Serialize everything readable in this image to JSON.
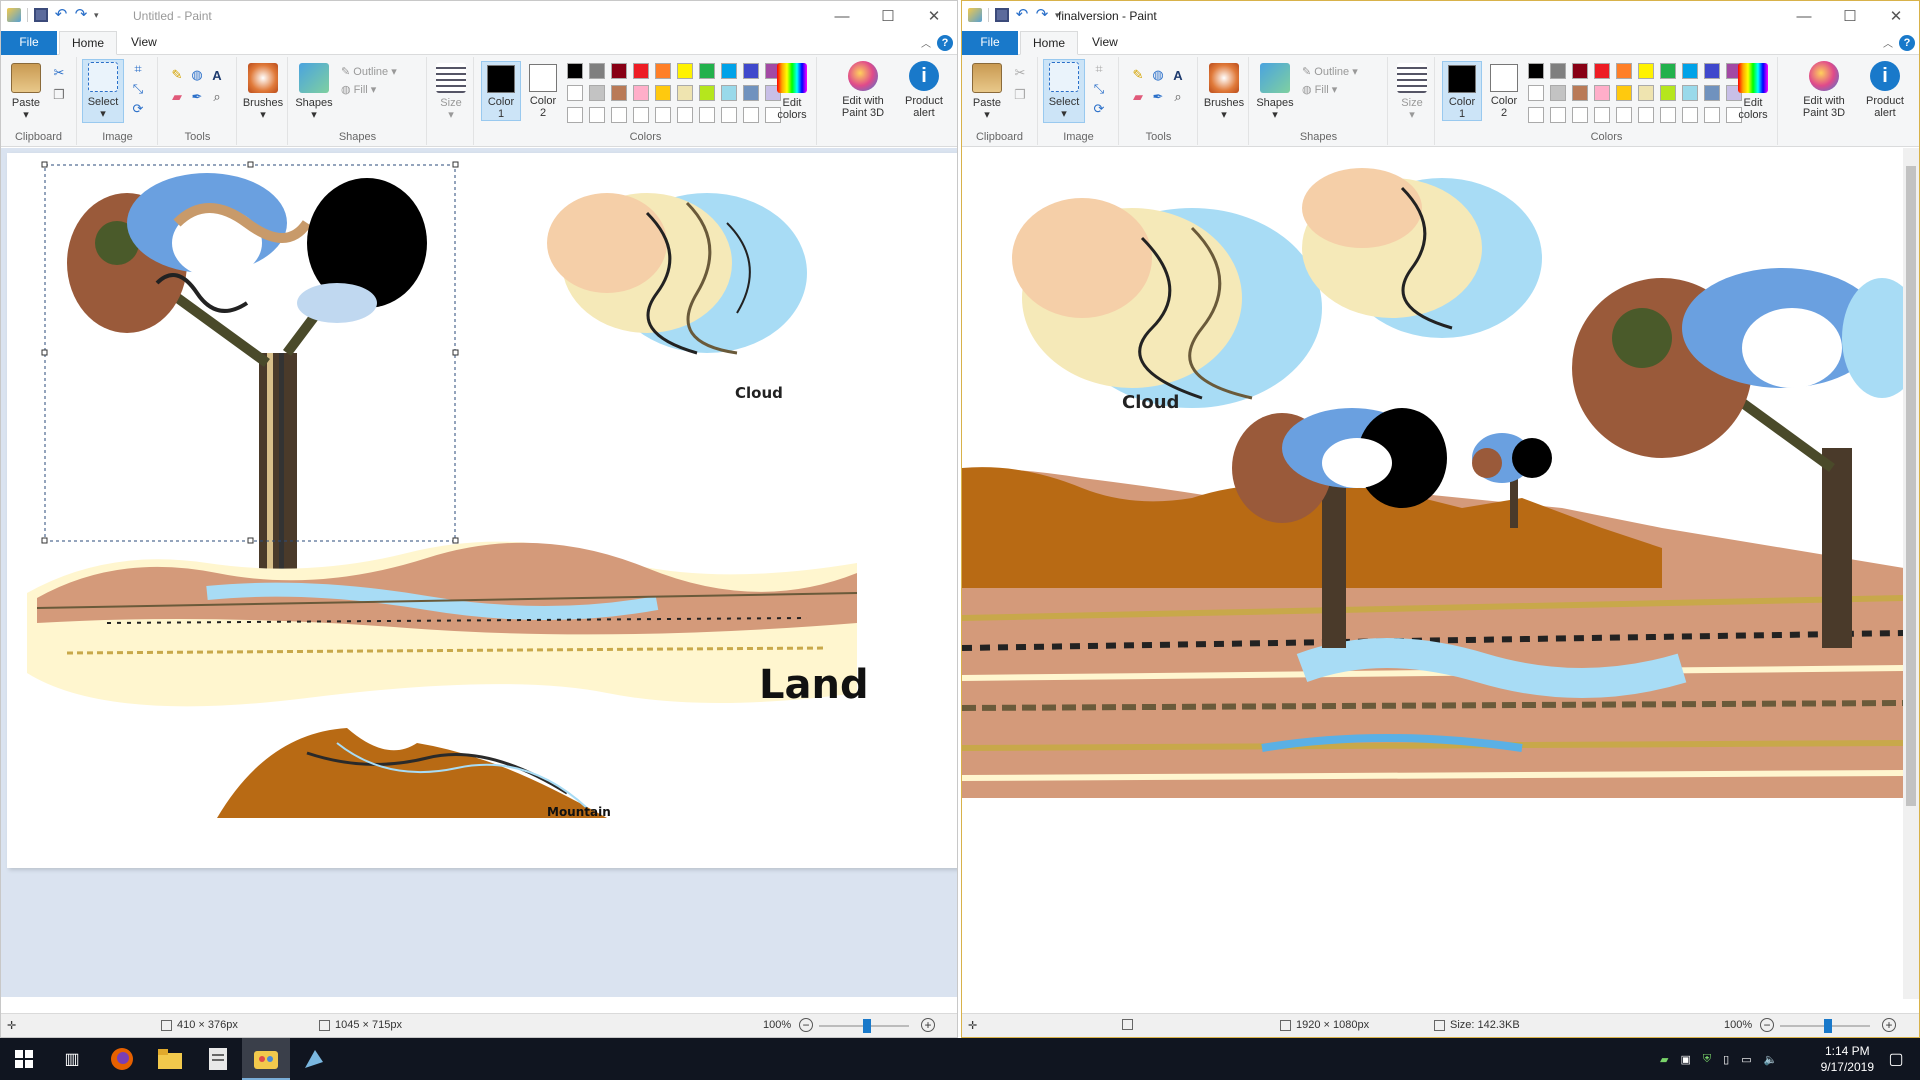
{
  "colors": {
    "accent": "#1979ca",
    "canvas_bg": "#dae3f0",
    "taskbar": "#101520"
  },
  "left_window": {
    "title": "Untitled - Paint",
    "tabs": {
      "file": "File",
      "home": "Home",
      "view": "View"
    },
    "status": {
      "selection_size": "410 × 376px",
      "image_size": "1045 × 715px",
      "zoom": "100%"
    },
    "canvas_labels": {
      "cloud": "Cloud",
      "land": "Land",
      "mountain": "Mountain"
    }
  },
  "right_window": {
    "title": "finalversion - Paint",
    "tabs": {
      "file": "File",
      "home": "Home",
      "view": "View"
    },
    "status": {
      "image_size": "1920 × 1080px",
      "file_size": "Size: 142.3KB",
      "zoom": "100%"
    },
    "canvas_labels": {
      "cloud": "Cloud"
    }
  },
  "ribbon": {
    "paste": "Paste",
    "clipboard": "Clipboard",
    "select": "Select",
    "image": "Image",
    "tools": "Tools",
    "brushes": "Brushes",
    "shapes": "Shapes",
    "shapes_group": "Shapes",
    "outline": "Outline",
    "fill": "Fill",
    "size": "Size",
    "color1": "Color",
    "color1_num": "1",
    "color2": "Color",
    "color2_num": "2",
    "colors_group": "Colors",
    "edit_colors": "Edit",
    "edit_colors2": "colors",
    "edit_paint3d": "Edit with",
    "edit_paint3d2": "Paint 3D",
    "product_alert": "Product",
    "product_alert2": "alert",
    "palette": [
      "#000000",
      "#7f7f7f",
      "#880015",
      "#ed1c24",
      "#ff7f27",
      "#fff200",
      "#22b14c",
      "#00a2e8",
      "#3f48cc",
      "#a349a4",
      "#ffffff",
      "#c3c3c3",
      "#b97a57",
      "#ffaec9",
      "#ffc90e",
      "#efe4b0",
      "#b5e61d",
      "#99d9ea",
      "#7092be",
      "#c8bfe7",
      "#ffffff",
      "#ffffff",
      "#ffffff",
      "#ffffff",
      "#ffffff",
      "#ffffff",
      "#ffffff",
      "#ffffff",
      "#ffffff",
      "#ffffff"
    ]
  },
  "taskbar": {
    "time": "1:14 PM",
    "date": "9/17/2019"
  }
}
